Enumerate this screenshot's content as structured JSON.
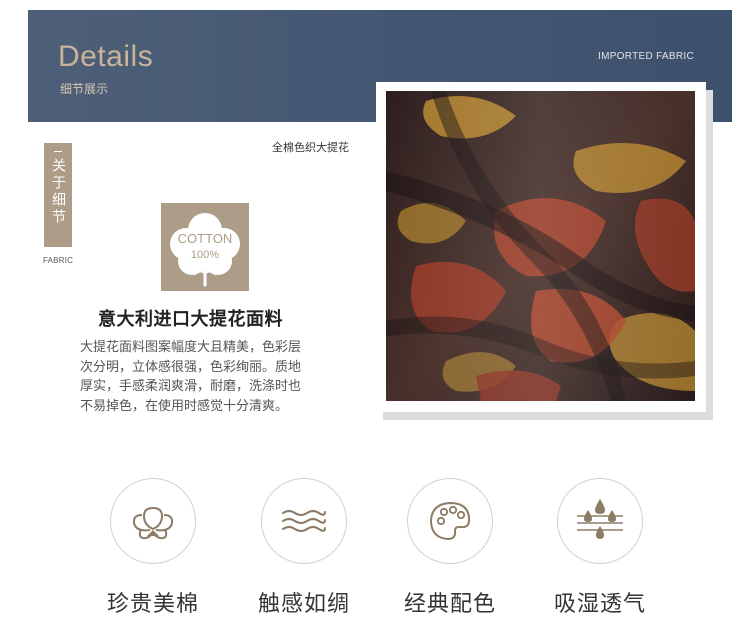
{
  "header": {
    "title": "Details",
    "subtitle": "细节展示",
    "tag": "IMPORTED FABRIC"
  },
  "side_tab": {
    "label": "关于细节",
    "caption": "FABRIC"
  },
  "note": "全棉色织大提花",
  "badge": {
    "line1": "COTTON",
    "line2": "100%"
  },
  "product": {
    "heading": "意大利进口大提花面料",
    "description_lines": [
      "大提花面料图案幅度大且精美，色彩层",
      "次分明，立体感很强，色彩绚丽。质地",
      "厚实，手感柔润爽滑，耐磨，洗涤时也",
      "不易掉色，在使用时感觉十分清爽。"
    ]
  },
  "features": [
    {
      "label": "珍贵美棉",
      "icon": "cotton-flower-icon"
    },
    {
      "label": "触感如绸",
      "icon": "silk-waves-icon"
    },
    {
      "label": "经典配色",
      "icon": "palette-icon"
    },
    {
      "label": "吸湿透气",
      "icon": "moisture-drops-icon"
    }
  ],
  "colors": {
    "banner": "#455873",
    "accent_gold": "#c9b49a",
    "tan": "#ad9d88",
    "icon_brown": "#8c7b66",
    "fabric_dark": "#3a2626",
    "fabric_rust": "#a8412a",
    "fabric_gold": "#b8872f"
  }
}
